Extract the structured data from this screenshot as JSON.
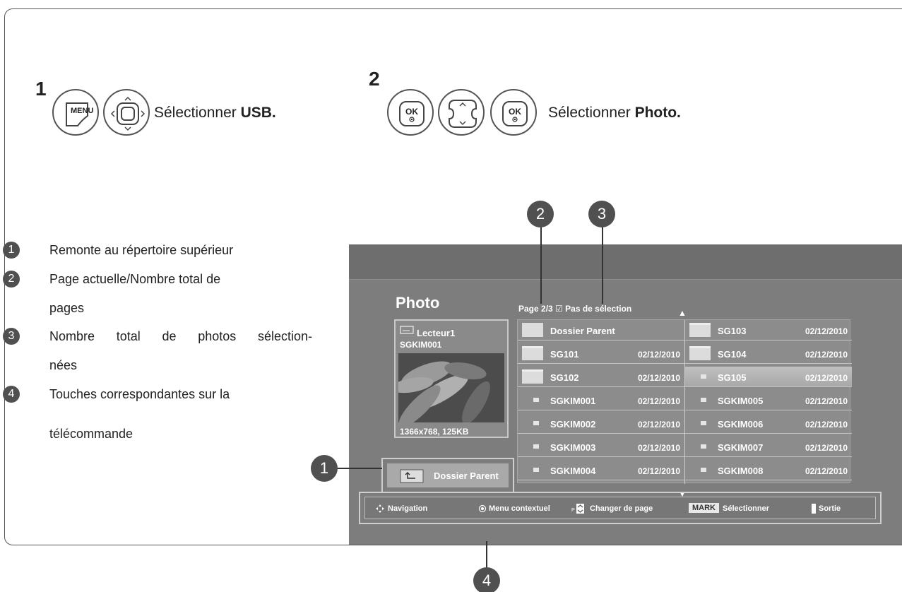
{
  "steps": [
    {
      "number": "1",
      "text_prefix": "Sélectionner ",
      "text_bold": "USB.",
      "buttons": [
        "MENU",
        "navigation-pad"
      ]
    },
    {
      "number": "2",
      "text_prefix": "Sélectionner ",
      "text_bold": "Photo.",
      "buttons": [
        "OK",
        "up-down-pad",
        "OK"
      ]
    }
  ],
  "button_labels": {
    "menu": "MENU",
    "ok": "OK"
  },
  "legend": [
    {
      "num": "1",
      "lines": [
        "Remonte au répertoire supérieur"
      ]
    },
    {
      "num": "2",
      "lines": [
        "Page actuelle/Nombre total de",
        "pages"
      ]
    },
    {
      "num": "3",
      "lines": [
        "Nombre total de photos sélection-",
        "nées"
      ]
    },
    {
      "num": "4",
      "lines": [
        "Touches correspondantes sur la",
        "télécommande"
      ]
    }
  ],
  "callouts": [
    "1",
    "2",
    "3",
    "4"
  ],
  "screen": {
    "title": "Photo",
    "page_info": "Page 2/3",
    "selection_info": "Pas de sélection",
    "preview": {
      "drive": "Lecteur1",
      "file": "SGKIM001",
      "info": "1366x768, 125KB"
    },
    "parent_button": "Dossier Parent",
    "list_left": [
      {
        "name": "Dossier Parent",
        "date": "",
        "icon": "parent"
      },
      {
        "name": "SG101",
        "date": "02/12/2010",
        "icon": "folder"
      },
      {
        "name": "SG102",
        "date": "02/12/2010",
        "icon": "folder"
      },
      {
        "name": "SGKIM001",
        "date": "02/12/2010",
        "icon": "file"
      },
      {
        "name": "SGKIM002",
        "date": "02/12/2010",
        "icon": "file"
      },
      {
        "name": "SGKIM003",
        "date": "02/12/2010",
        "icon": "file"
      },
      {
        "name": "SGKIM004",
        "date": "02/12/2010",
        "icon": "file"
      }
    ],
    "list_right": [
      {
        "name": "SG103",
        "date": "02/12/2010",
        "icon": "folder"
      },
      {
        "name": "SG104",
        "date": "02/12/2010",
        "icon": "folder"
      },
      {
        "name": "SG105",
        "date": "02/12/2010",
        "icon": "file",
        "selected": true
      },
      {
        "name": "SGKIM005",
        "date": "02/12/2010",
        "icon": "file"
      },
      {
        "name": "SGKIM006",
        "date": "02/12/2010",
        "icon": "file"
      },
      {
        "name": "SGKIM007",
        "date": "02/12/2010",
        "icon": "file"
      },
      {
        "name": "SGKIM008",
        "date": "02/12/2010",
        "icon": "file"
      }
    ],
    "hints": {
      "navigation": "Navigation",
      "menu": "Menu contextuel",
      "page": "Changer de page",
      "mark_badge": "MARK",
      "select": "Sélectionner",
      "exit": "Sortie"
    }
  }
}
